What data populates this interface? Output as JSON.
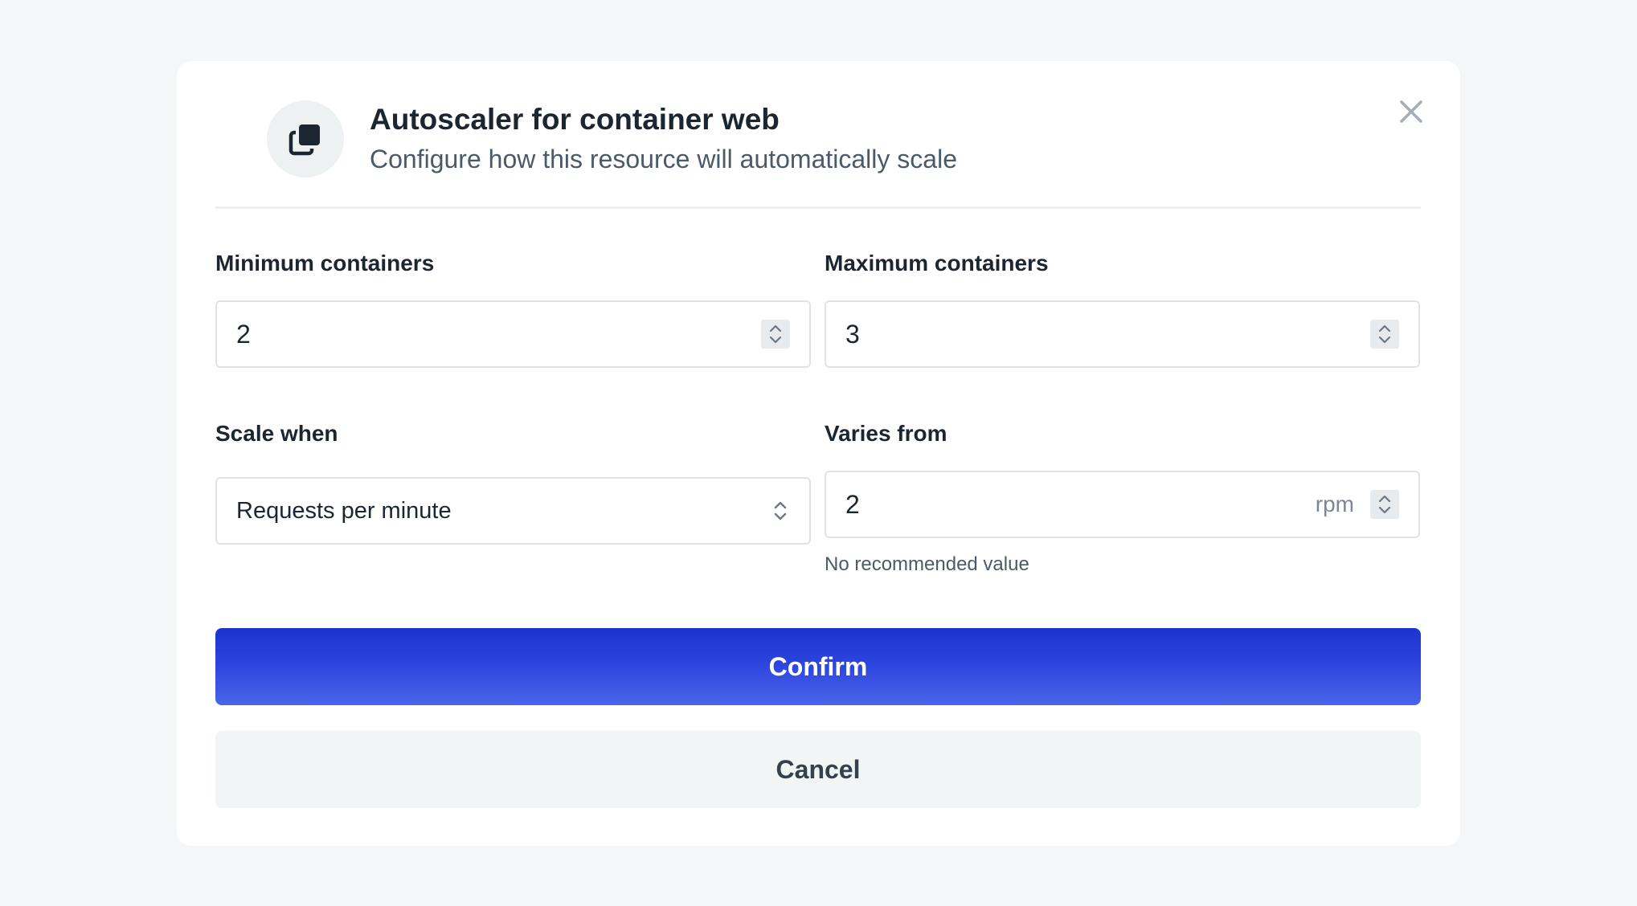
{
  "modal": {
    "title": "Autoscaler for container web",
    "subtitle": "Configure how this resource will automatically scale",
    "icon": "stacked-squares-icon"
  },
  "fields": {
    "min_containers": {
      "label": "Minimum containers",
      "value": "2"
    },
    "max_containers": {
      "label": "Maximum containers",
      "value": "3"
    },
    "scale_when": {
      "label": "Scale when",
      "value": "Requests per minute"
    },
    "varies_from": {
      "label": "Varies from",
      "value": "2",
      "unit": "rpm",
      "hint": "No recommended value"
    }
  },
  "actions": {
    "confirm_label": "Confirm",
    "cancel_label": "Cancel"
  },
  "colors": {
    "accent": "#2c44de",
    "background": "#f4f6f7"
  }
}
